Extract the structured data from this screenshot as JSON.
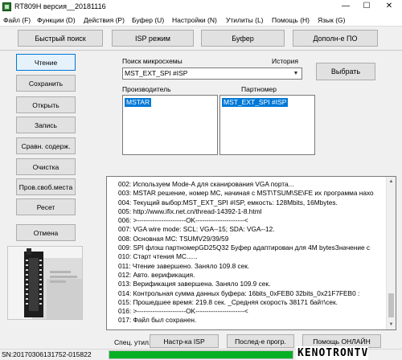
{
  "window": {
    "title": "RT809H версия__20181116",
    "controls": {
      "minimize": "—",
      "maximize": "☐",
      "close": "✕"
    }
  },
  "menu": [
    "Файл (F)",
    "Функции (D)",
    "Действия (P)",
    "Буфер (U)",
    "Настройки (N)",
    "Утилиты (L)",
    "Помощь (H)",
    "Язык (G)"
  ],
  "toolbar": {
    "quick_search": "Быстрый поиск",
    "isp_mode": "ISP режим",
    "buffer": "Буфер",
    "additional": "Дополн-е ПО"
  },
  "left_buttons": [
    "Чтение",
    "Сохранить",
    "Открыть",
    "Запись",
    "Сравн. содерж.",
    "Очистка",
    "Пров.своб.места",
    "Ресет",
    "Отмена"
  ],
  "chip_search": {
    "label": "Поиск микросхемы",
    "history_label": "История",
    "value": "MST_EXT_SPI #ISP",
    "select_button": "Выбрать"
  },
  "manufacturer": {
    "label": "Производитель",
    "selected": "MSTAR"
  },
  "partnumber": {
    "label": "Партномер",
    "selected": "MST_EXT_SPI #ISP"
  },
  "log": [
    "002: Используем Mode-A для сканирования VGA порта...",
    "003: MSTAR решение, номер MC, начиная с MST\\TSUM\\SE\\FE их программа нахо",
    "004: Текущий выбор:MST_EXT_SPI #ISP, емкость: 128Mbits, 16Mbytes.",
    "005: http://www.ifix.net.cn/thread-14392-1-8.html",
    "006: >----------------------OK----------------------<",
    "007: VGA wire mode: SCL: VGA--15; SDA: VGA--12.",
    "008: Основная MC: TSUMV29/39/59",
    "009: SPI флэш партномерGD25Q32 Буфер адаптирован для 4M bytesЗначение с",
    "010: Старт чтения MC......",
    "011: Чтение завершено. Заняло 109.8 сек.",
    "012: Авто. верификация.",
    "013: Верификация завершена. Заняло 109.9 сек.",
    "014: Контрольная сумма данных буфера: 16bits_0xFEB0  32bits_0x21F7FEB0 :",
    "015: Прошедшее время: 219.8 сек. _Средняя скорость 38171 байт\\сек.",
    "016: >----------------------OK----------------------<",
    "017: Файл был сохранен."
  ],
  "bottom": {
    "spec_label": "Спец. утил.",
    "isp_settings": "Настр-ка ISP",
    "last_prog": "Послед-е прогр.",
    "online_help": "Помощь ОНЛАЙН"
  },
  "status": {
    "sn": "SN:20170306131752-015822",
    "progress": 1.0,
    "progress_color": "#06b025"
  },
  "watermark": "KENOTRONTV",
  "colors": {
    "selection": "#0078d7",
    "button": "#e1e1e1",
    "window_bg": "#f0f0f0"
  }
}
